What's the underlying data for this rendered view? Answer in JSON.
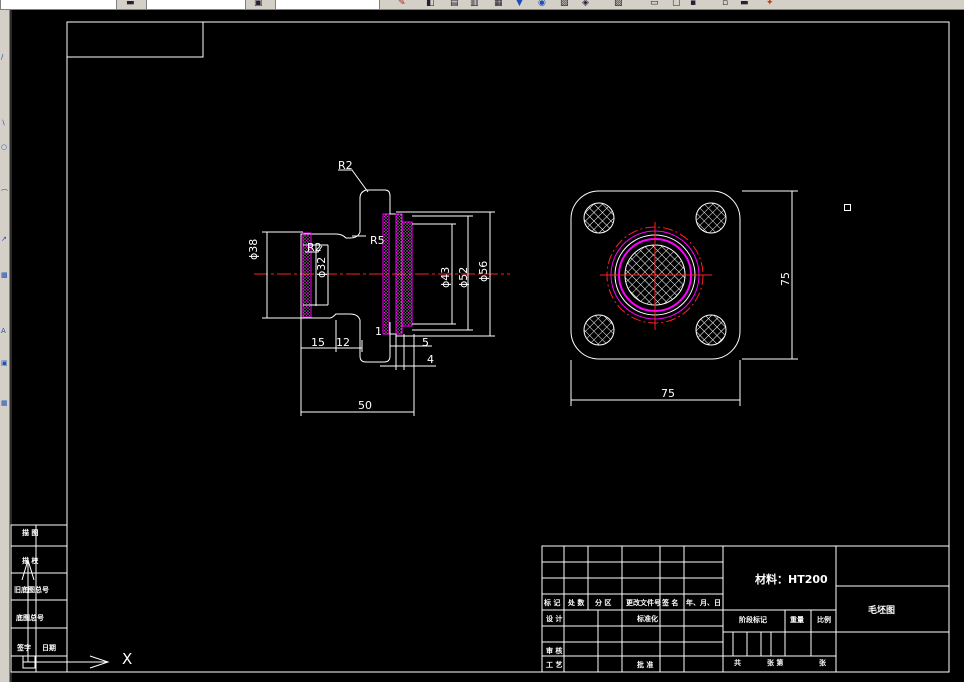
{
  "ui": {
    "toolbar_icons": [
      "tool-icon",
      "print-icon",
      "copy-icon",
      "paste-icon",
      "undo-icon",
      "redo-icon",
      "zoom-icon",
      "pan-icon",
      "properties-icon",
      "layer-icon",
      "snap-icon",
      "render-icon"
    ],
    "cursor_marker": "pickbox"
  },
  "colors": {
    "background": "#000000",
    "lines": "#ffffff",
    "hidden": "#ff00ff",
    "center": "#ff0000",
    "hatch": "#ffffff"
  },
  "drawing": {
    "dimensions": {
      "front": {
        "r2_top": "R2",
        "r2_left": "R2",
        "r5": "R5",
        "d38": "ϕ38",
        "d32": "ϕ32",
        "d43": "ϕ43",
        "d52": "ϕ52",
        "d56": "ϕ56",
        "len15": "15",
        "len12": "12",
        "len1": "1",
        "len5": "5",
        "len4": "4",
        "len50": "50"
      },
      "side": {
        "width": "75",
        "height": "75"
      }
    },
    "title_block": {
      "material": "材料：HT200",
      "drawing_name": "毛坯图",
      "head_row": [
        "标 记",
        "处 数",
        "分  区",
        "更改文件号",
        "签 名",
        "年、月、日"
      ],
      "designer": "设 计",
      "standardized": "标准化",
      "reviewer": "审 核",
      "process": "工 艺",
      "approver": "批 准",
      "stage_mark": "阶段标记",
      "weight": "重量",
      "scale": "比例",
      "total": "共",
      "sheets": "张 第",
      "sheet": "张"
    },
    "left_table": {
      "row1": "描  图",
      "row2": "描  校",
      "row3": "旧底图总号",
      "row4": "底图总号",
      "row5": "签字",
      "row6": "日期"
    },
    "ucs_label": "X"
  }
}
